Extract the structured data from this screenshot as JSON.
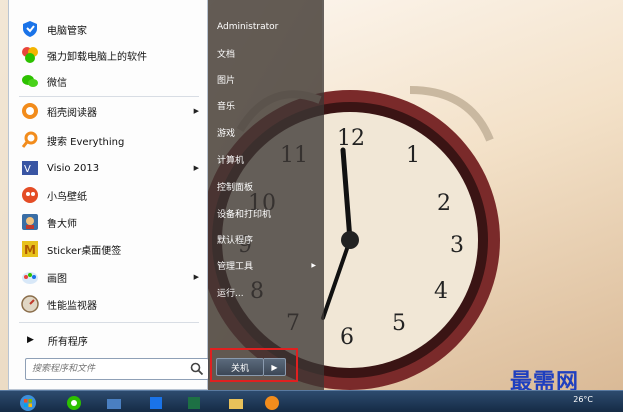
{
  "start_menu": {
    "programs": [
      {
        "label": "电脑管家",
        "icon": "shield-icon",
        "color": "#1a73e8",
        "has_arrow": false
      },
      {
        "label": "强力卸载电脑上的软件",
        "icon": "uninstall-icon",
        "color": "#e8453c",
        "has_arrow": false
      },
      {
        "label": "微信",
        "icon": "wechat-icon",
        "color": "#2dc100",
        "has_arrow": false
      },
      {
        "label": "稻壳阅读器",
        "icon": "reader-icon",
        "color": "#f28c1c",
        "has_arrow": true
      },
      {
        "label": "搜索 Everything",
        "icon": "magnifier-icon",
        "color": "#f28c1c",
        "has_arrow": false
      },
      {
        "label": "Visio 2013",
        "icon": "visio-icon",
        "color": "#3955a3",
        "has_arrow": true
      },
      {
        "label": "小鸟壁纸",
        "icon": "bird-icon",
        "color": "#e44d26",
        "has_arrow": false
      },
      {
        "label": "鲁大师",
        "icon": "ludashi-icon",
        "color": "#3a6ea5",
        "has_arrow": false
      },
      {
        "label": "Sticker桌面便签",
        "icon": "sticker-icon",
        "color": "#e8c21c",
        "has_arrow": false
      },
      {
        "label": "画图",
        "icon": "paint-icon",
        "color": "#4b8fd8",
        "has_arrow": true
      },
      {
        "label": "性能监视器",
        "icon": "monitor-icon",
        "color": "#8a6d4a",
        "has_arrow": false
      }
    ],
    "all_programs_label": "所有程序",
    "search_placeholder": "搜索程序和文件",
    "right_items": [
      {
        "label": "Administrator",
        "has_arrow": false
      },
      {
        "label": "文档",
        "has_arrow": false
      },
      {
        "label": "图片",
        "has_arrow": false
      },
      {
        "label": "音乐",
        "has_arrow": false
      },
      {
        "label": "游戏",
        "has_arrow": false
      },
      {
        "label": "计算机",
        "has_arrow": false
      },
      {
        "label": "控制面板",
        "has_arrow": false
      },
      {
        "label": "设备和打印机",
        "has_arrow": false
      },
      {
        "label": "默认程序",
        "has_arrow": false
      },
      {
        "label": "管理工具",
        "has_arrow": true
      },
      {
        "label": "运行...",
        "has_arrow": false
      }
    ],
    "shutdown_label": "关机"
  },
  "taskbar": {
    "temperature": "26°C"
  },
  "watermark": "最需网",
  "colors": {
    "highlight_border": "#e02020",
    "watermark": "#1f3fbf"
  }
}
